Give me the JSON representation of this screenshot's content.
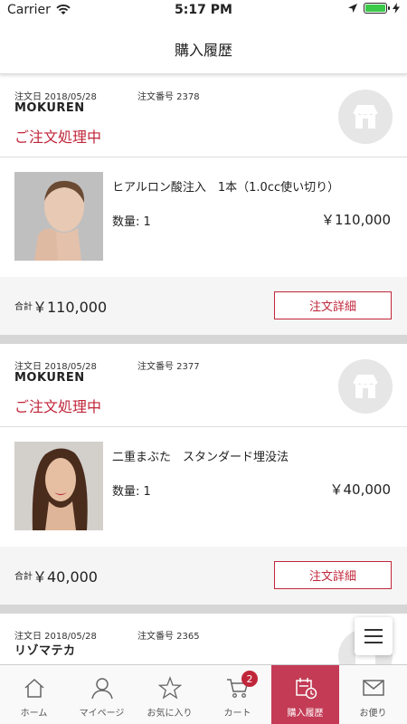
{
  "status_bar": {
    "carrier": "Carrier",
    "time": "5:17 PM"
  },
  "nav": {
    "title": "購入履歴"
  },
  "orders": [
    {
      "date": "注文日 2018/05/28",
      "number": "注文番号 2378",
      "clinic": "MOKUREN",
      "status": "ご注文処理中",
      "item_name": "ヒアルロン酸注入　1本（1.0cc使い切り）",
      "qty": "数量: 1",
      "price": "￥110,000",
      "total_label": "合計",
      "total": "￥110,000",
      "detail_label": "注文詳細"
    },
    {
      "date": "注文日 2018/05/28",
      "number": "注文番号 2377",
      "clinic": "MOKUREN",
      "status": "ご注文処理中",
      "item_name": "二重まぶた　スタンダード埋没法",
      "qty": "数量: 1",
      "price": "￥40,000",
      "total_label": "合計",
      "total": "￥40,000",
      "detail_label": "注文詳細"
    },
    {
      "date": "注文日 2018/05/28",
      "number": "注文番号 2365",
      "clinic": "リゾマテカ"
    }
  ],
  "tabs": [
    {
      "label": "ホーム",
      "icon": "home-icon"
    },
    {
      "label": "マイページ",
      "icon": "user-icon"
    },
    {
      "label": "お気に入り",
      "icon": "star-icon"
    },
    {
      "label": "カート",
      "icon": "cart-icon",
      "badge": "2"
    },
    {
      "label": "購入履歴",
      "icon": "history-icon"
    },
    {
      "label": "お便り",
      "icon": "mail-icon"
    }
  ],
  "colors": {
    "accent": "#c0263a",
    "active_tab": "#c33b55",
    "separator": "#d6d6d6"
  }
}
